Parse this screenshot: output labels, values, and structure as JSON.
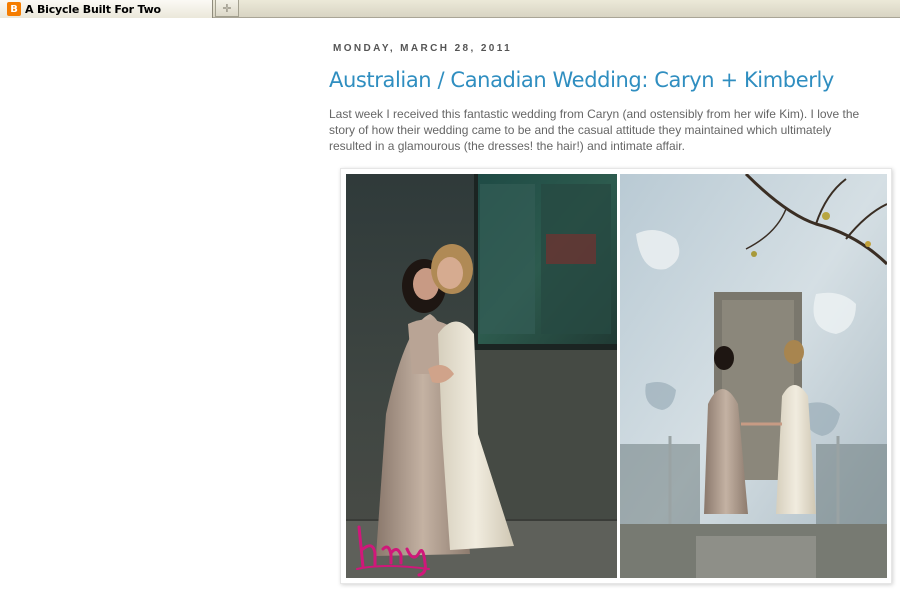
{
  "browser": {
    "tab_title": "A Bicycle Built For Two",
    "favicon_icon": "blogger-icon",
    "favicon_color": "#f57d00",
    "new_tab_icon": "plus-icon"
  },
  "post": {
    "date": "Monday, March 28, 2011",
    "title": "Australian / Canadian Wedding: Caryn + Kimberly",
    "body": "Last week I received this fantastic wedding from Caryn (and ostensibly from her wife Kim). I love the story of how their wedding came to be and the casual attitude they maintained which ultimately resulted in a glamourous (the dresses! the hair!) and intimate affair.",
    "title_color": "#2f8ec0",
    "body_color": "#666666"
  },
  "photo": {
    "subject": "wedding-photo-diptych",
    "watermark_color": "#d0177a"
  }
}
